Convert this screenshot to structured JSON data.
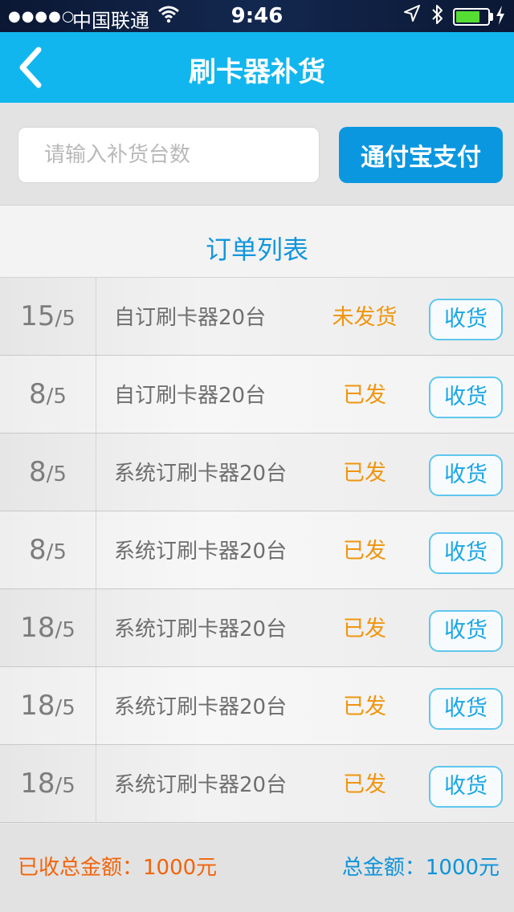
{
  "status_bar": {
    "signal": "●●●●○",
    "carrier": "中国联通",
    "wifi_icon": "wifi-icon",
    "time": "9:46",
    "battery_level": 0.75
  },
  "nav": {
    "back_icon": "chevron-left-icon",
    "title": "刷卡器补货"
  },
  "restock": {
    "input_placeholder": "请输入补货台数",
    "input_value": "",
    "pay_label": "通付宝支付"
  },
  "list": {
    "title": "订单列表",
    "orders": [
      {
        "day": "15",
        "month": "5",
        "product": "自订刷卡器20台",
        "status": "未发货",
        "action": "收货"
      },
      {
        "day": "8",
        "month": "5",
        "product": "自订刷卡器20台",
        "status": "已发",
        "action": "收货"
      },
      {
        "day": "8",
        "month": "5",
        "product": "系统订刷卡器20台",
        "status": "已发",
        "action": "收货"
      },
      {
        "day": "8",
        "month": "5",
        "product": "系统订刷卡器20台",
        "status": "已发",
        "action": "收货"
      },
      {
        "day": "18",
        "month": "5",
        "product": "系统订刷卡器20台",
        "status": "已发",
        "action": "收货"
      },
      {
        "day": "18",
        "month": "5",
        "product": "系统订刷卡器20台",
        "status": "已发",
        "action": "收货"
      },
      {
        "day": "18",
        "month": "5",
        "product": "系统订刷卡器20台",
        "status": "已发",
        "action": "收货"
      }
    ]
  },
  "footer": {
    "received_total": "已收总金额：1000元",
    "grand_total": "总金额：1000元"
  },
  "colors": {
    "nav_blue": "#12b6ee",
    "pay_blue": "#0a97e0",
    "status_orange": "#f0950e",
    "received_orange": "#f2640c",
    "total_blue": "#0d93db"
  }
}
